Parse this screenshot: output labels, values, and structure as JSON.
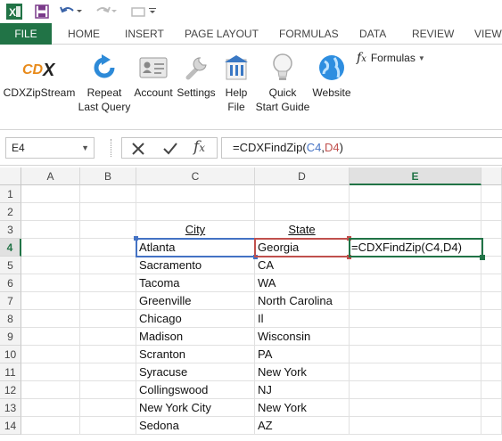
{
  "qat": {
    "icons": [
      "excel-logo-icon",
      "save-icon",
      "undo-icon",
      "redo-icon",
      "customize-icon"
    ]
  },
  "tabs": [
    "FILE",
    "HOME",
    "INSERT",
    "PAGE LAYOUT",
    "FORMULAS",
    "DATA",
    "REVIEW",
    "VIEW"
  ],
  "ribbon": {
    "buttons": [
      {
        "label": "CDXZipStream",
        "icon": "cdx-logo-icon"
      },
      {
        "label": "Repeat\nLast Query",
        "icon": "repeat-icon"
      },
      {
        "label": "Account",
        "icon": "account-card-icon"
      },
      {
        "label": "Settings",
        "icon": "wrench-icon"
      },
      {
        "label": "Help\nFile",
        "icon": "help-file-icon"
      },
      {
        "label": "Quick\nStart Guide",
        "icon": "lightbulb-icon"
      },
      {
        "label": "Website",
        "icon": "globe-icon"
      }
    ],
    "formulas_menu": "Formulas"
  },
  "formula_bar": {
    "name_box": "E4",
    "formula_prefix": "=CDXFindZip(",
    "ref1": "C4",
    "comma": ",",
    "ref2": "D4",
    "formula_suffix": ")"
  },
  "columns": [
    "A",
    "B",
    "C",
    "D",
    "E"
  ],
  "rows": [
    "1",
    "2",
    "3",
    "4",
    "5",
    "6",
    "7",
    "8",
    "9",
    "10",
    "11",
    "12",
    "13",
    "14"
  ],
  "sheet": {
    "header_city": "City",
    "header_state": "State",
    "active_formula": "=CDXFindZip(C4,D4)",
    "data": [
      [
        "Atlanta",
        "Georgia"
      ],
      [
        "Sacramento",
        "CA"
      ],
      [
        "Tacoma",
        "WA"
      ],
      [
        "Greenville",
        "North Carolina"
      ],
      [
        "Chicago",
        "Il"
      ],
      [
        "Madison",
        "Wisconsin"
      ],
      [
        "Scranton",
        "PA"
      ],
      [
        "Syracuse",
        "New York"
      ],
      [
        "Collingswood",
        "NJ"
      ],
      [
        "New York City",
        "New York"
      ],
      [
        "Sedona",
        "AZ"
      ]
    ]
  },
  "colors": {
    "excel_green": "#217346",
    "ref_blue": "#4472c4",
    "ref_red": "#c0504d"
  }
}
